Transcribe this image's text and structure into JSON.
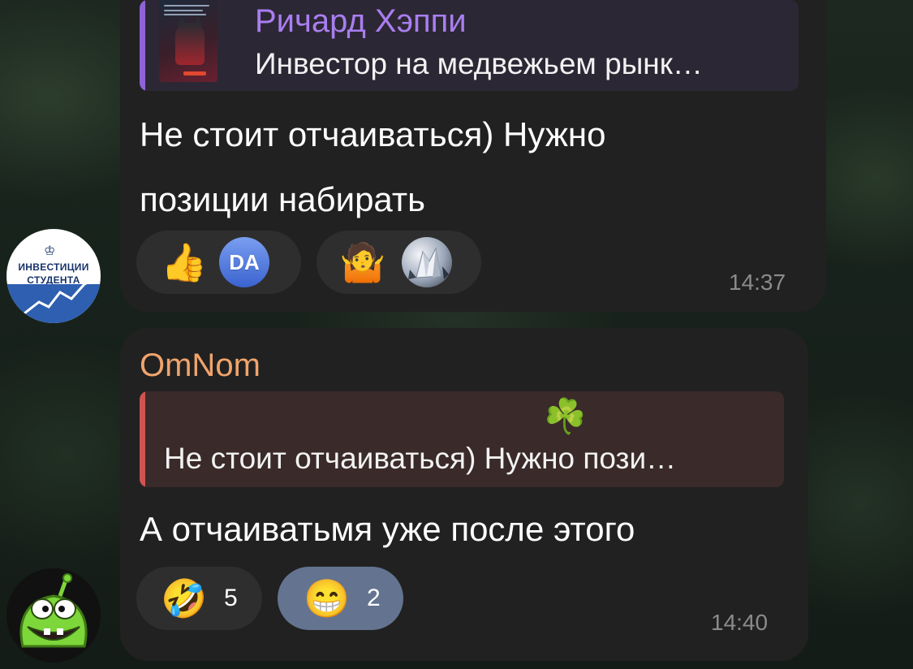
{
  "messages": [
    {
      "reply": {
        "name": "Ричард Хэппи",
        "snippet": "Инвестор на медвежьем рынк…",
        "thumbnail": "article-thumbnail"
      },
      "text_line1": "Не стоит отчаиваться) Нужно",
      "text_line2": "позиции набирать",
      "reactions": [
        {
          "emoji": "👍",
          "reactor": "DA"
        },
        {
          "emoji": "🤷",
          "reactor": "crystal-avatar"
        }
      ],
      "time": "14:37",
      "author_avatar": {
        "line1": "ИНВЕСТИЦИИ",
        "line2": "СТУДЕНТА",
        "crown": "♔"
      }
    },
    {
      "sender": "OmNom",
      "reply": {
        "decoration": "☘️",
        "snippet": "Не стоит отчаиваться) Нужно пози…"
      },
      "text": "А отчаиватьмя уже после этого",
      "reactions": [
        {
          "emoji": "🤣",
          "count": "5"
        },
        {
          "emoji": "😁",
          "count": "2",
          "selected": true
        }
      ],
      "time": "14:40",
      "author_avatar": "omnom-avatar"
    }
  ],
  "colors": {
    "bubble": "#212121",
    "reply_accent_1": "#8f63d6",
    "reply_accent_2": "#d0534f",
    "sender_name": "#f0a46c",
    "selected_reaction": "#647490"
  }
}
